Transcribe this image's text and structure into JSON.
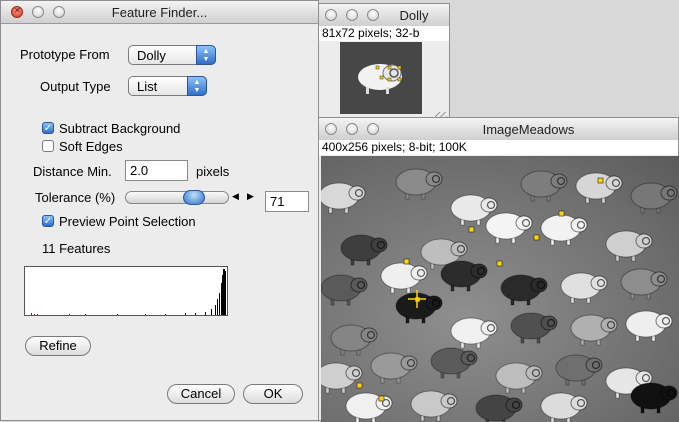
{
  "feature_finder": {
    "title": "Feature Finder...",
    "prototype_from_label": "Prototype From",
    "prototype_from_value": "Dolly",
    "output_type_label": "Output Type",
    "output_type_value": "List",
    "subtract_background_label": "Subtract Background",
    "subtract_background_checked": true,
    "soft_edges_label": "Soft Edges",
    "soft_edges_checked": false,
    "distance_min_label": "Distance Min.",
    "distance_min_value": "2.0",
    "distance_min_unit": "pixels",
    "tolerance_label": "Tolerance (%)",
    "tolerance_value": "71",
    "tolerance_fraction": 0.71,
    "preview_label": "Preview Point Selection",
    "preview_checked": true,
    "features_count": "11 Features",
    "refine_label": "Refine",
    "cancel_label": "Cancel",
    "ok_label": "OK"
  },
  "dolly_window": {
    "title": "Dolly",
    "info": "81x72 pixels; 32-b"
  },
  "meadows_window": {
    "title": "ImageMeadows",
    "info": "400x256 pixels; 8-bit; 100K"
  },
  "colors": {
    "accent_blue": "#3a7bd5",
    "marker_yellow": "#ffd400",
    "histogram_red": "#b40000"
  }
}
